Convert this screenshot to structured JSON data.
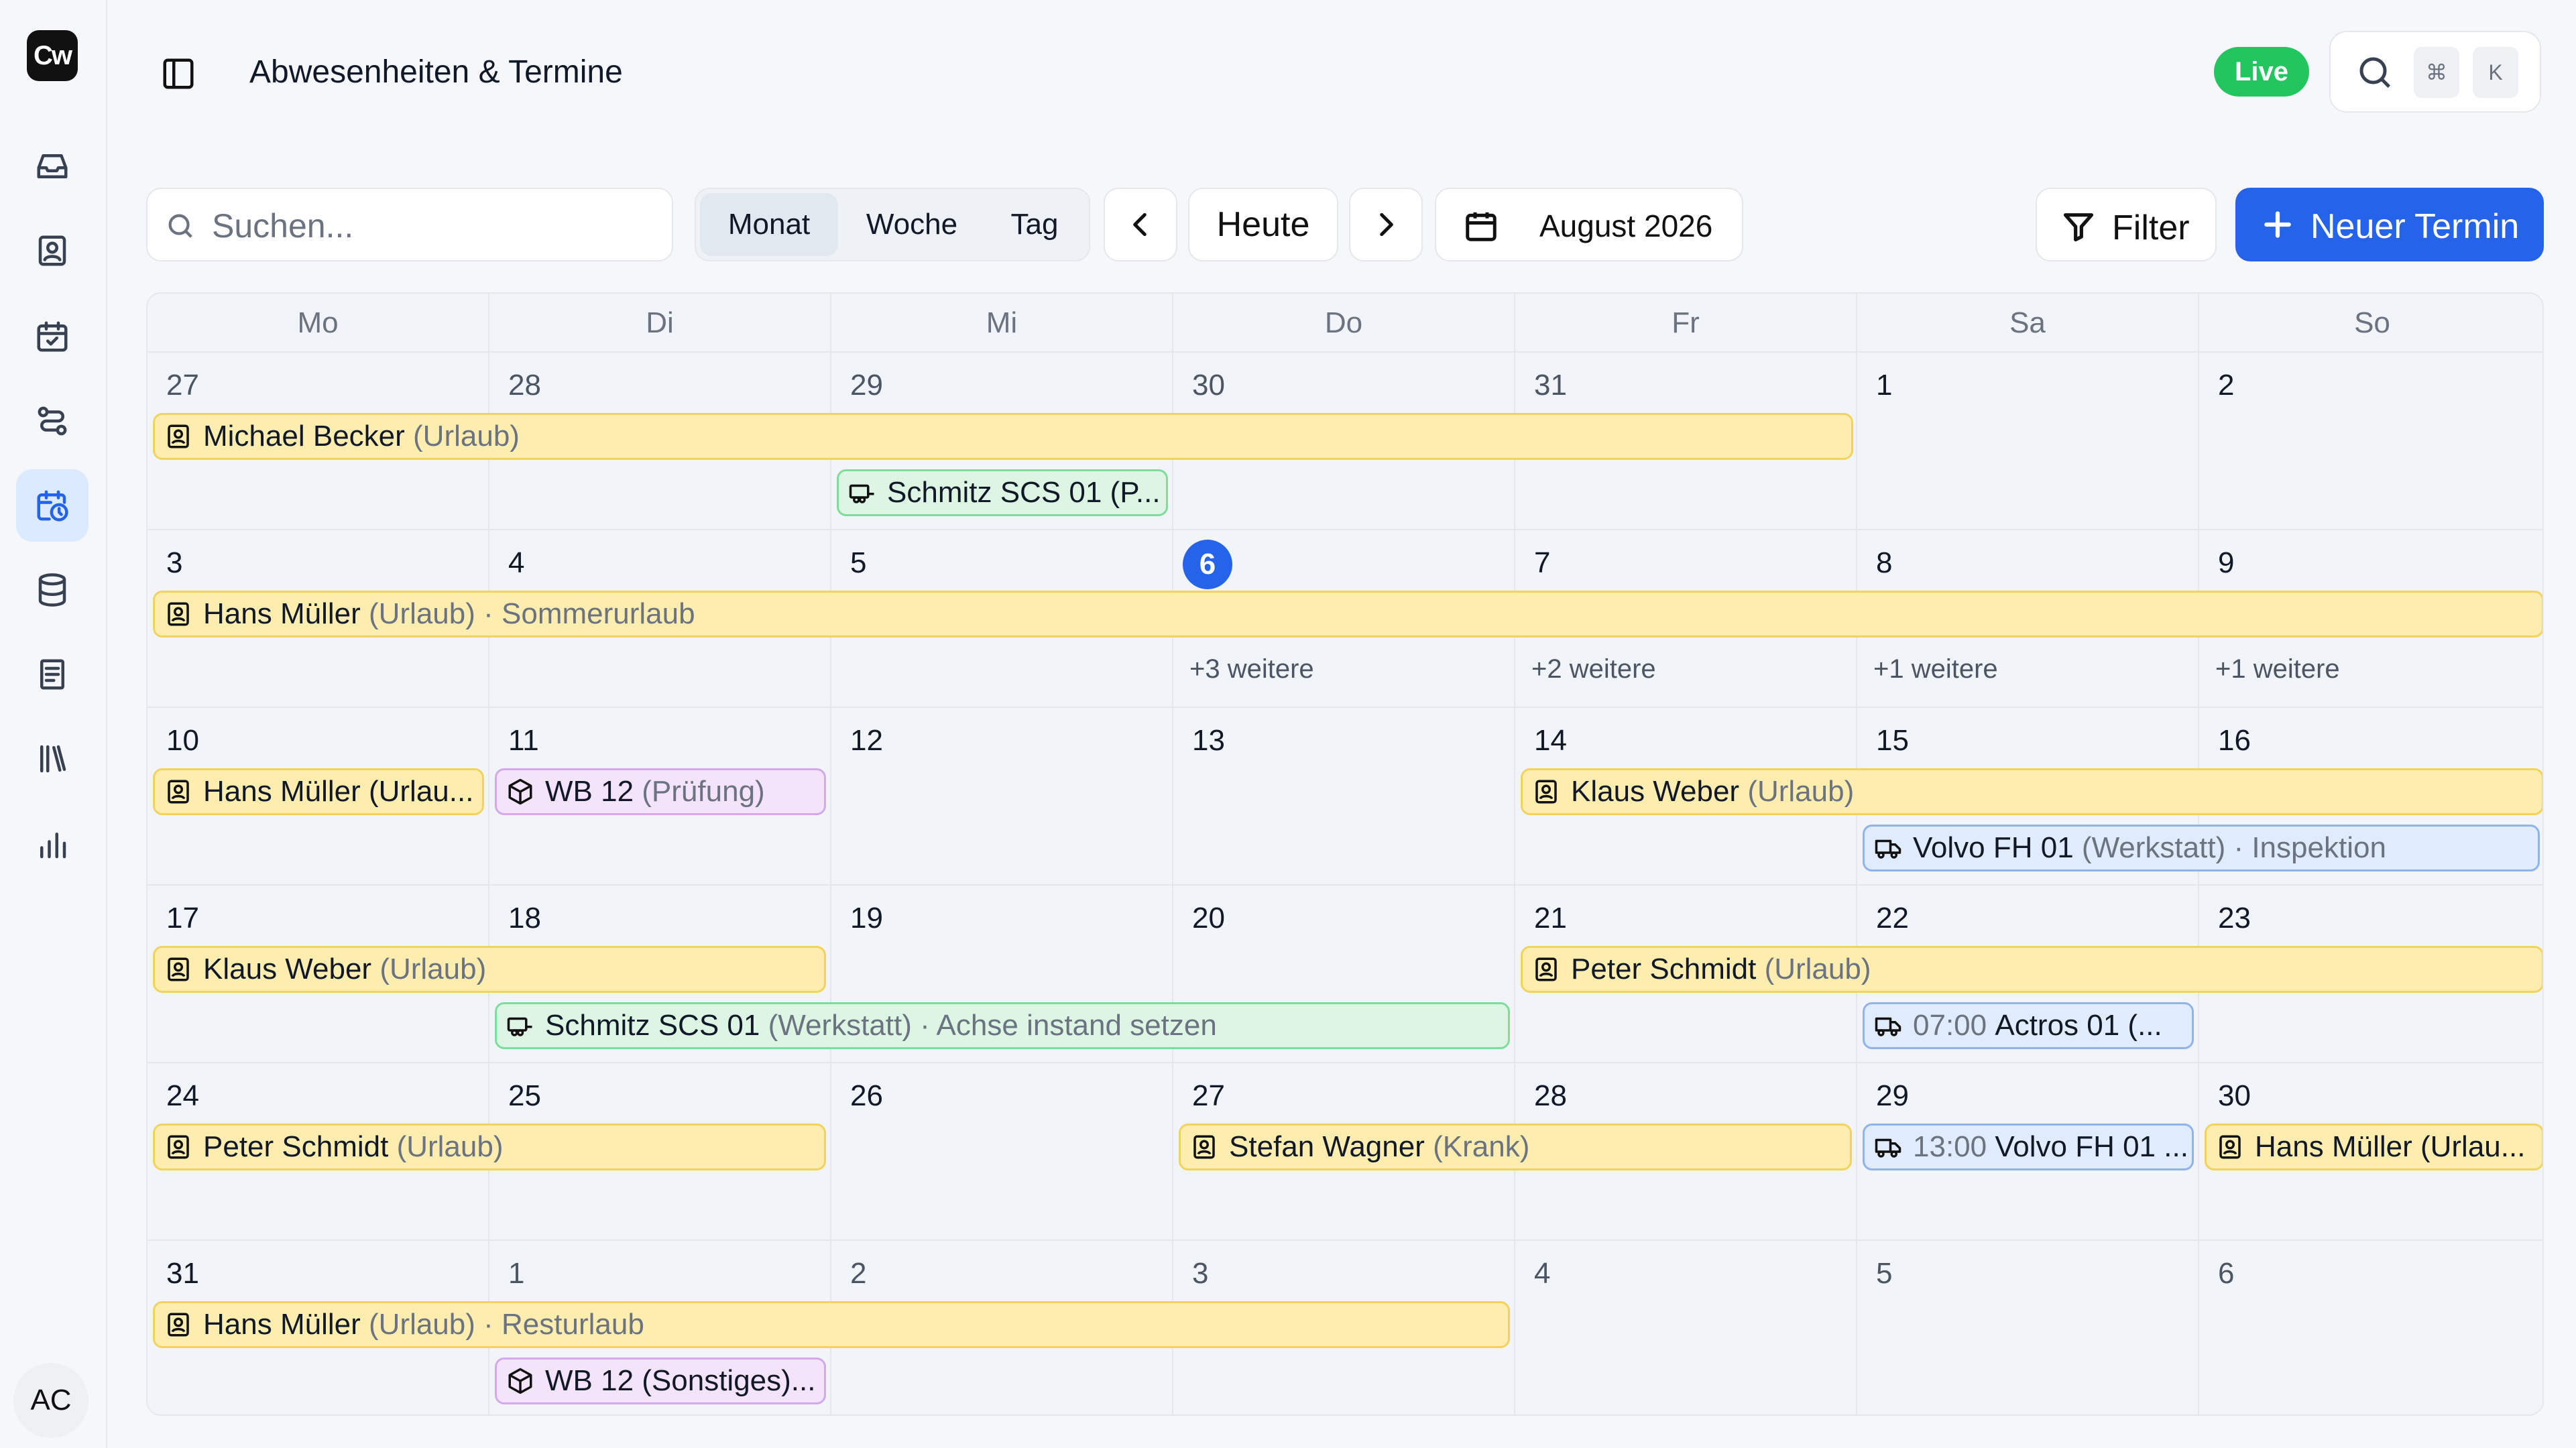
{
  "app": {
    "logo": "Cw",
    "title": "Abwesenheiten & Termine",
    "live_label": "Live",
    "avatar_initials": "AC"
  },
  "shortcut": {
    "key1": "⌘",
    "key2": "K"
  },
  "sidebar": {
    "items": [
      {
        "icon": "inbox-icon"
      },
      {
        "icon": "contact-card-icon"
      },
      {
        "icon": "calendar-check-icon"
      },
      {
        "icon": "route-icon"
      },
      {
        "icon": "calendar-clock-icon",
        "active": true
      },
      {
        "icon": "database-icon"
      },
      {
        "icon": "document-icon"
      },
      {
        "icon": "library-icon"
      },
      {
        "icon": "bar-chart-icon"
      }
    ]
  },
  "toolbar": {
    "search_placeholder": "Suchen...",
    "views": [
      "Monat",
      "Woche",
      "Tag"
    ],
    "active_view": "Monat",
    "today_label": "Heute",
    "current_month": "August 2026",
    "filter_label": "Filter",
    "new_event_label": "Neuer Termin"
  },
  "calendar": {
    "weekdays": [
      "Mo",
      "Di",
      "Mi",
      "Do",
      "Fr",
      "Sa",
      "So"
    ],
    "weeks": [
      [
        "27",
        "28",
        "29",
        "30",
        "31",
        "1",
        "2"
      ],
      [
        "3",
        "4",
        "5",
        "6",
        "7",
        "8",
        "9"
      ],
      [
        "10",
        "11",
        "12",
        "13",
        "14",
        "15",
        "16"
      ],
      [
        "17",
        "18",
        "19",
        "20",
        "21",
        "22",
        "23"
      ],
      [
        "24",
        "25",
        "26",
        "27",
        "28",
        "29",
        "30"
      ],
      [
        "31",
        "1",
        "2",
        "3",
        "4",
        "5",
        "6"
      ]
    ],
    "today": "6",
    "more_links": [
      "+3 weitere",
      "+2 weitere",
      "+1 weitere",
      "+1 weitere"
    ],
    "events": [
      {
        "name": "Michael Becker",
        "sub": "(Urlaub)"
      },
      {
        "name": "Schmitz SCS 01 (P...",
        "sub": ""
      },
      {
        "name": "Hans Müller",
        "sub": "(Urlaub) · Sommerurlaub"
      },
      {
        "name": "Hans Müller (Urlau...",
        "sub": ""
      },
      {
        "name": "WB 12",
        "sub": "(Prüfung)"
      },
      {
        "name": "Klaus Weber",
        "sub": "(Urlaub)"
      },
      {
        "name": "Volvo FH 01",
        "sub": "(Werkstatt) · Inspektion"
      },
      {
        "name": "Klaus Weber",
        "sub": "(Urlaub)"
      },
      {
        "name": "Peter Schmidt",
        "sub": "(Urlaub)"
      },
      {
        "name": "Schmitz SCS 01",
        "sub": "(Werkstatt) · Achse instand setzen"
      },
      {
        "time": "07:00",
        "name": "Actros 01 (...",
        "sub": ""
      },
      {
        "name": "Peter Schmidt",
        "sub": "(Urlaub)"
      },
      {
        "name": "Stefan Wagner",
        "sub": "(Krank)"
      },
      {
        "time": "13:00",
        "name": "Volvo FH 01 ...",
        "sub": ""
      },
      {
        "name": "Hans Müller (Urlau...",
        "sub": ""
      },
      {
        "name": "Hans Müller",
        "sub": "(Urlaub) · Resturlaub"
      },
      {
        "name": "WB 12 (Sonstiges)...",
        "sub": ""
      }
    ]
  }
}
